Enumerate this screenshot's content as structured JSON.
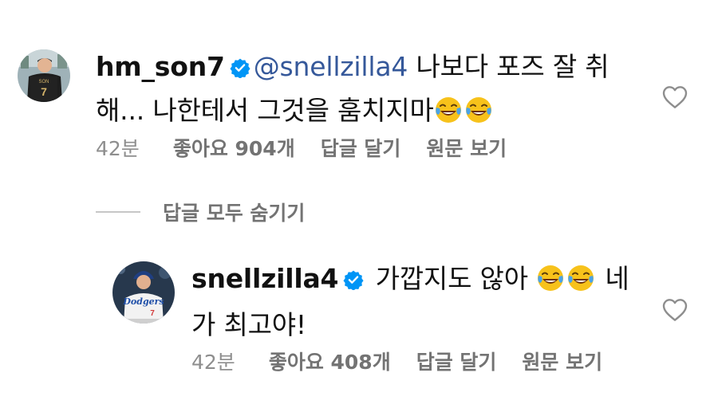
{
  "comments": [
    {
      "username": "hm_son7",
      "verified": true,
      "mention": "@snellzilla4",
      "line1_text": " 나보다 포즈 잘 취",
      "line2_text": "해... 나한테서 그것을 훔치지마",
      "emojis": [
        "tears-of-joy-emoji",
        "tears-of-joy-emoji"
      ],
      "time": "42분",
      "likes": "좋아요 904개",
      "reply": "답글 달기",
      "translate": "원문 보기",
      "avatar_icon": "profile-photo-black-jersey"
    },
    {
      "username": "snellzilla4",
      "verified": true,
      "line1_text": " 가깝지도 않아 ",
      "line1_after": " 네",
      "line2_text": "가 최고야!",
      "emojis": [
        "tears-of-joy-emoji",
        "tears-of-joy-emoji"
      ],
      "time": "42분",
      "likes": "좋아요 408개",
      "reply": "답글 달기",
      "translate": "원문 보기",
      "avatar_icon": "profile-photo-dodgers-uniform"
    }
  ],
  "hide_replies_label": "답글 모두 숨기기",
  "colors": {
    "verified": "#0095f6",
    "mention": "#35589a",
    "meta": "#8e8e8e",
    "emoji_face": "#f7c21b",
    "emoji_tear": "#4aa3e8"
  }
}
